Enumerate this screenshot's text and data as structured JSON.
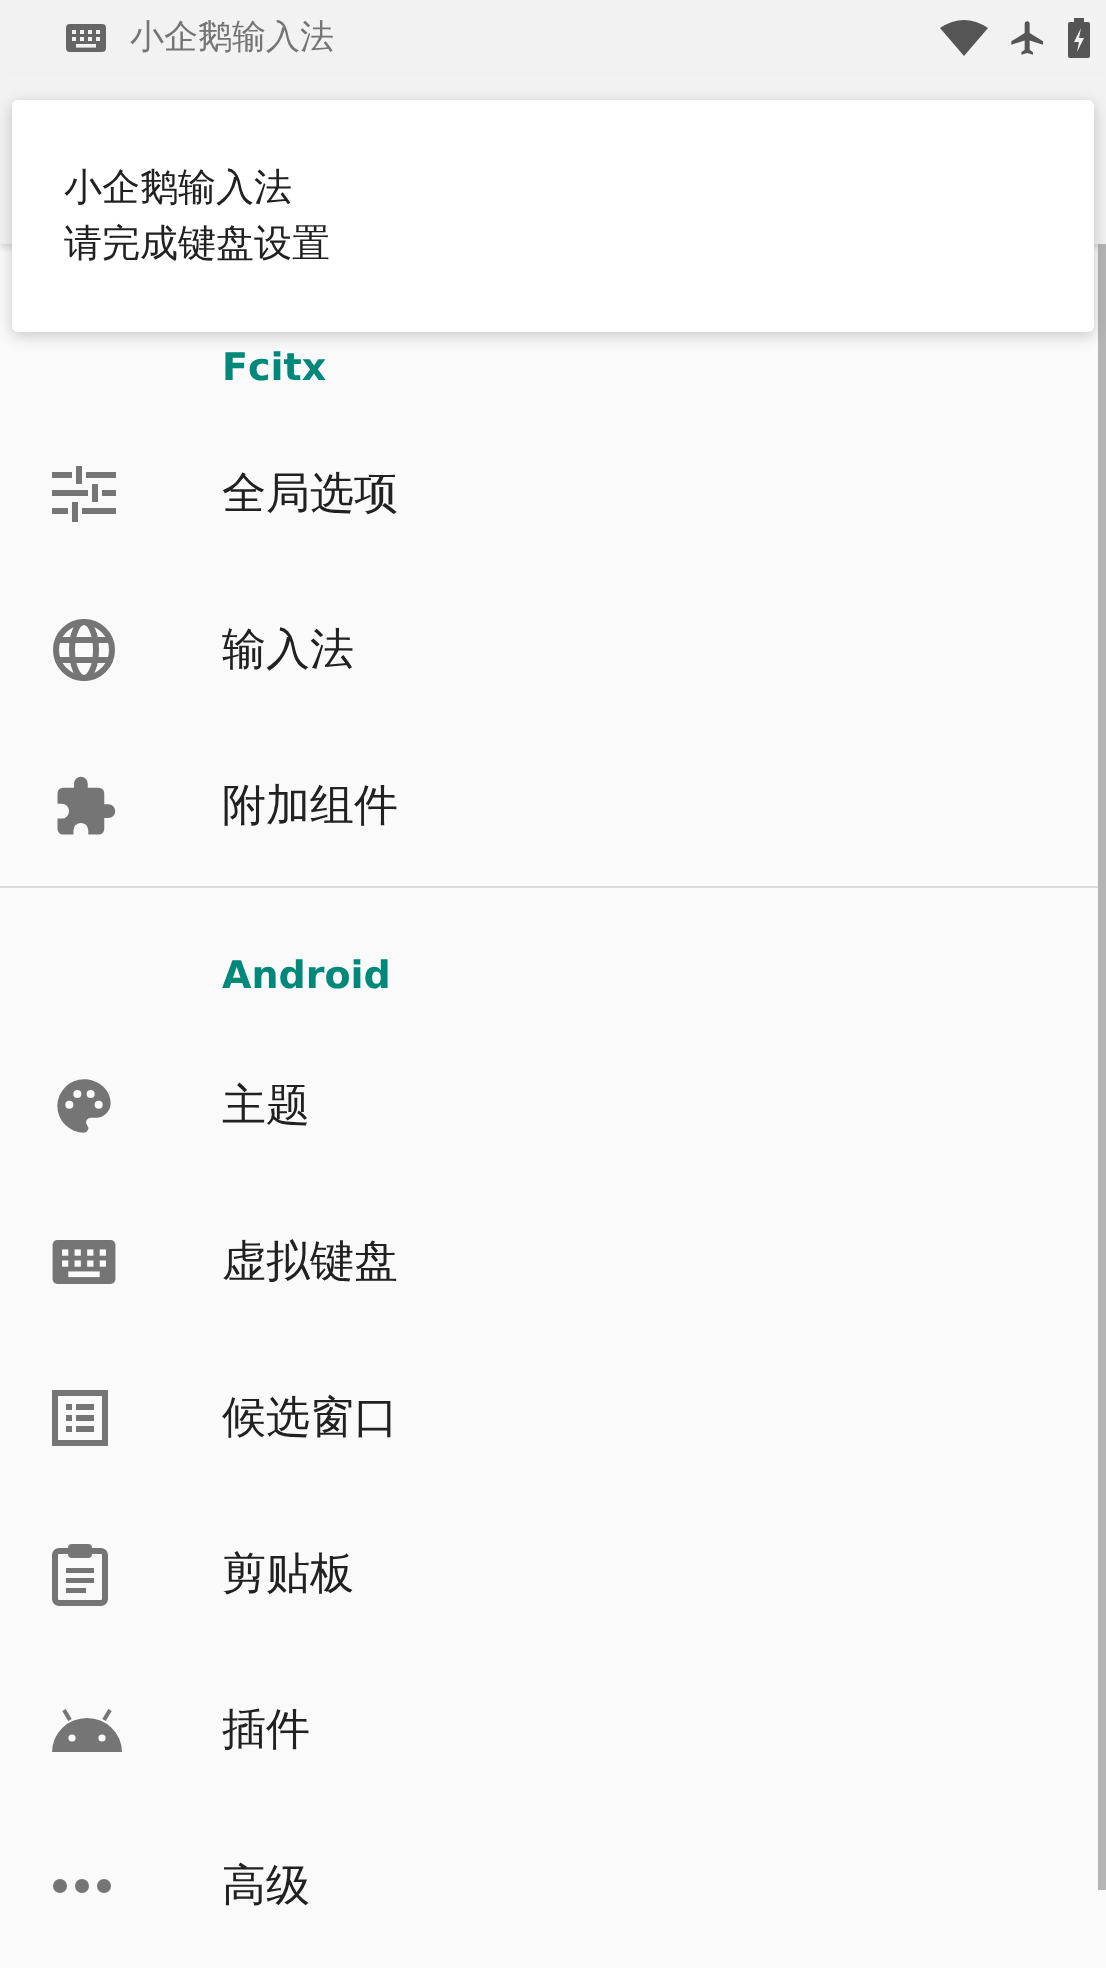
{
  "status_bar": {
    "app_name": "小企鹅输入法"
  },
  "notification": {
    "title": "小企鹅输入法",
    "text": "请完成键盘设置"
  },
  "sections": [
    {
      "title": "Fcitx",
      "items": [
        {
          "label": "全局选项",
          "kind": "sliders"
        },
        {
          "label": "输入法",
          "kind": "globe"
        },
        {
          "label": "附加组件",
          "kind": "puzzle"
        }
      ]
    },
    {
      "title": "Android",
      "items": [
        {
          "label": "主题",
          "kind": "palette"
        },
        {
          "label": "虚拟键盘",
          "kind": "keyboard"
        },
        {
          "label": "候选窗口",
          "kind": "list"
        },
        {
          "label": "剪贴板",
          "kind": "clipboard"
        },
        {
          "label": "插件",
          "kind": "android"
        },
        {
          "label": "高级",
          "kind": "more"
        }
      ]
    }
  ]
}
